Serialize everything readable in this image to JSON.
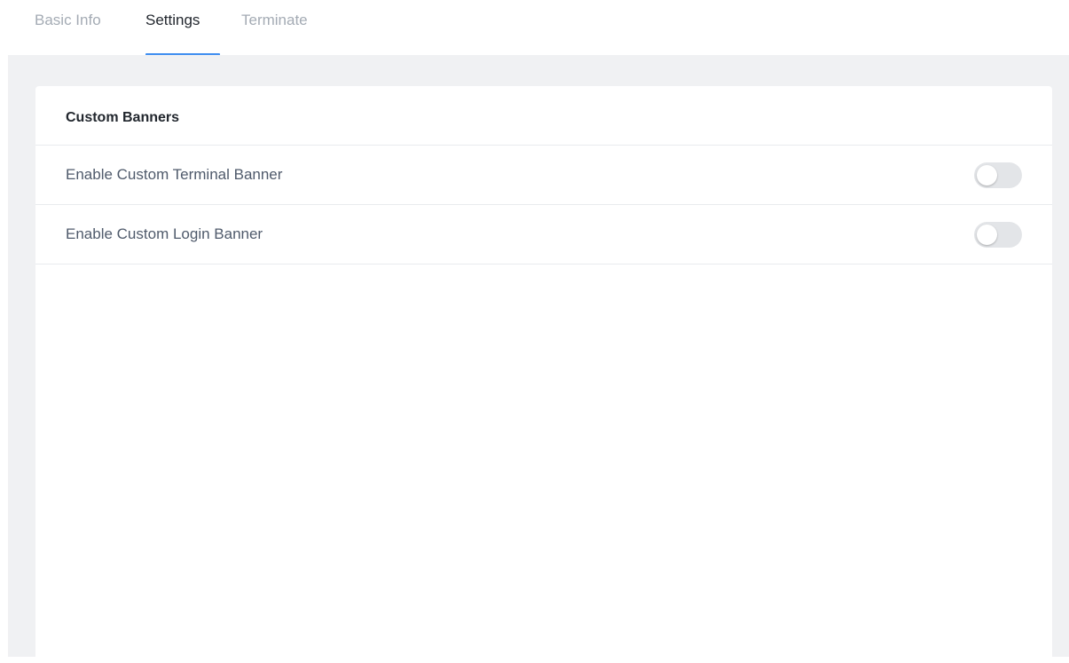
{
  "tabs": [
    {
      "label": "Basic Info",
      "active": false
    },
    {
      "label": "Settings",
      "active": true
    },
    {
      "label": "Terminate",
      "active": false
    }
  ],
  "card": {
    "title": "Custom Banners",
    "settings": [
      {
        "label": "Enable Custom Terminal Banner",
        "enabled": false
      },
      {
        "label": "Enable Custom Login Banner",
        "enabled": false
      }
    ]
  },
  "colors": {
    "accent": "#3f8ef0",
    "background": "#f0f1f3",
    "toggle_off": "#e3e5e8"
  }
}
